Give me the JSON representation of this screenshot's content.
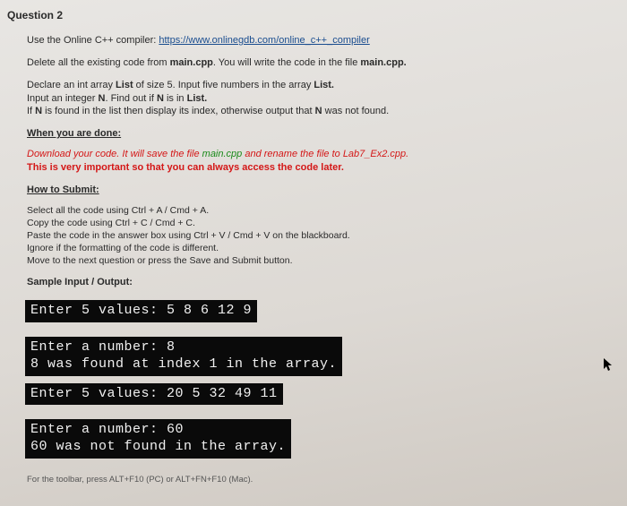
{
  "question_label": "Question 2",
  "intro": {
    "prefix": "Use the Online C++ compiler: ",
    "link_text": "https://www.onlinegdb.com/online_c++_compiler"
  },
  "delete_line": {
    "a": "Delete all the existing code from ",
    "b": "main.cpp",
    "c": ". You will write the code in the file ",
    "d": "main.cpp."
  },
  "instructions": {
    "l1a": "Declare an int array ",
    "l1b": "List",
    "l1c": " of size 5. Input five numbers in the array ",
    "l1d": "List.",
    "l2a": "Input an integer ",
    "l2b": "N",
    "l2c": ". Find out if ",
    "l2d": "N",
    "l2e": " is in ",
    "l2f": "List.",
    "l3a": "If ",
    "l3b": "N",
    "l3c": " is found in the list then display its index, otherwise output that ",
    "l3d": "N",
    "l3e": " was not found."
  },
  "when_done_head": "When you are done:",
  "download": {
    "p1": "Download your code. It will save the file ",
    "main": "main.cpp",
    "p2": " and rename the file to ",
    "lab": "Lab7_Ex2.cpp.",
    "line2": "This is very important so that you can always access the code later."
  },
  "how_submit_head": "How to Submit:",
  "submit": {
    "s1": "Select all the code using Ctrl + A / Cmd + A.",
    "s2": "Copy the code using Ctrl + C / Cmd + C.",
    "s3": "Paste the code in the answer box using Ctrl + V / Cmd + V on the blackboard.",
    "s4": "Ignore if the formatting of the code is different.",
    "s5": "Move to the next question or press the Save and Submit button."
  },
  "sample_head": "Sample Input / Output:",
  "terminal": {
    "t1": "Enter 5 values: 5 8 6 12 9",
    "t2a": "Enter a number: 8",
    "t2b": "8 was found at index 1 in the array.",
    "t3": "Enter 5 values: 20 5 32 49 11",
    "t4a": "Enter a number: 60",
    "t4b": "60 was not found in the array."
  },
  "footer": "For the toolbar, press ALT+F10 (PC) or ALT+FN+F10 (Mac)."
}
